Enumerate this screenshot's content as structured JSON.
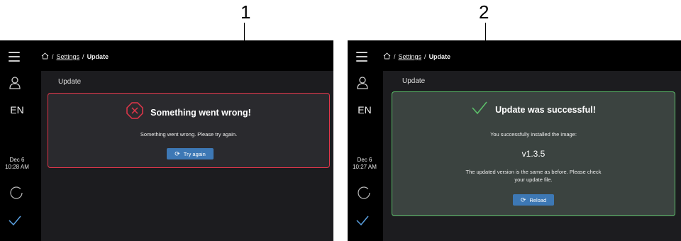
{
  "callouts": [
    "1",
    "2"
  ],
  "screens": [
    {
      "sidebar": {
        "language": "EN",
        "date": "Dec 6",
        "time": "10:28 AM"
      },
      "breadcrumb": {
        "sep": "/",
        "settings": "Settings",
        "current": "Update"
      },
      "section_title": "Update",
      "card": {
        "status": "error",
        "title": "Something went wrong!",
        "message": "Something went wrong. Please try again.",
        "button_label": "Try again"
      }
    },
    {
      "sidebar": {
        "language": "EN",
        "date": "Dec 6",
        "time": "10:27 AM"
      },
      "breadcrumb": {
        "sep": "/",
        "settings": "Settings",
        "current": "Update"
      },
      "section_title": "Update",
      "card": {
        "status": "success",
        "title": "Update was successful!",
        "message": "You successfully installed the image:",
        "version": "v1.3.5",
        "note_line1": "The updated version is the same as before. Please check",
        "note_line2": "your update file.",
        "button_label": "Reload"
      }
    }
  ],
  "colors": {
    "error": "#e2364a",
    "success": "#5cbf6a",
    "button": "#3d78b5"
  },
  "icons": [
    "menu-icon",
    "user-icon",
    "spinner-icon",
    "check-icon",
    "home-icon",
    "error-icon",
    "success-check-icon",
    "refresh-icon"
  ]
}
